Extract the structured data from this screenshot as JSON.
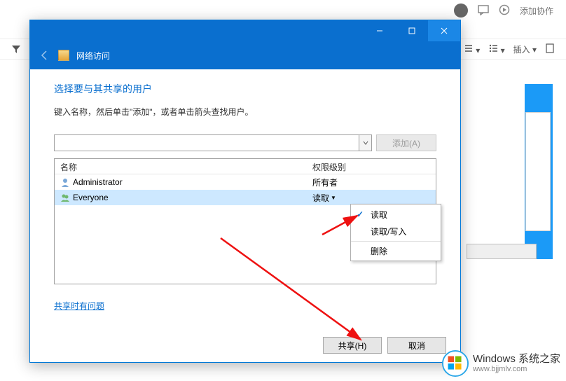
{
  "bg": {
    "top_action": "添加协作",
    "insert_label": "插入"
  },
  "dialog": {
    "window_title": "网络访问",
    "heading": "选择要与其共享的用户",
    "description": "键入名称，然后单击\"添加\"，或者单击箭头查找用户。",
    "add_button": "添加(A)",
    "columns": {
      "name": "名称",
      "permission": "权限级别"
    },
    "rows": [
      {
        "icon": "user",
        "name": "Administrator",
        "permission": "所有者",
        "selected": false,
        "has_dropdown": false
      },
      {
        "icon": "group",
        "name": "Everyone",
        "permission": "读取",
        "selected": true,
        "has_dropdown": true
      }
    ],
    "context_menu": {
      "items": [
        {
          "label": "读取",
          "checked": true
        },
        {
          "label": "读取/写入",
          "checked": false
        },
        {
          "label": "删除",
          "checked": false,
          "separated": true
        }
      ]
    },
    "help_link": "共享时有问题",
    "footer": {
      "share": "共享(H)",
      "cancel": "取消"
    }
  },
  "watermark": {
    "line1": "Windows 系统之家",
    "line2": "www.bjjmlv.com"
  }
}
